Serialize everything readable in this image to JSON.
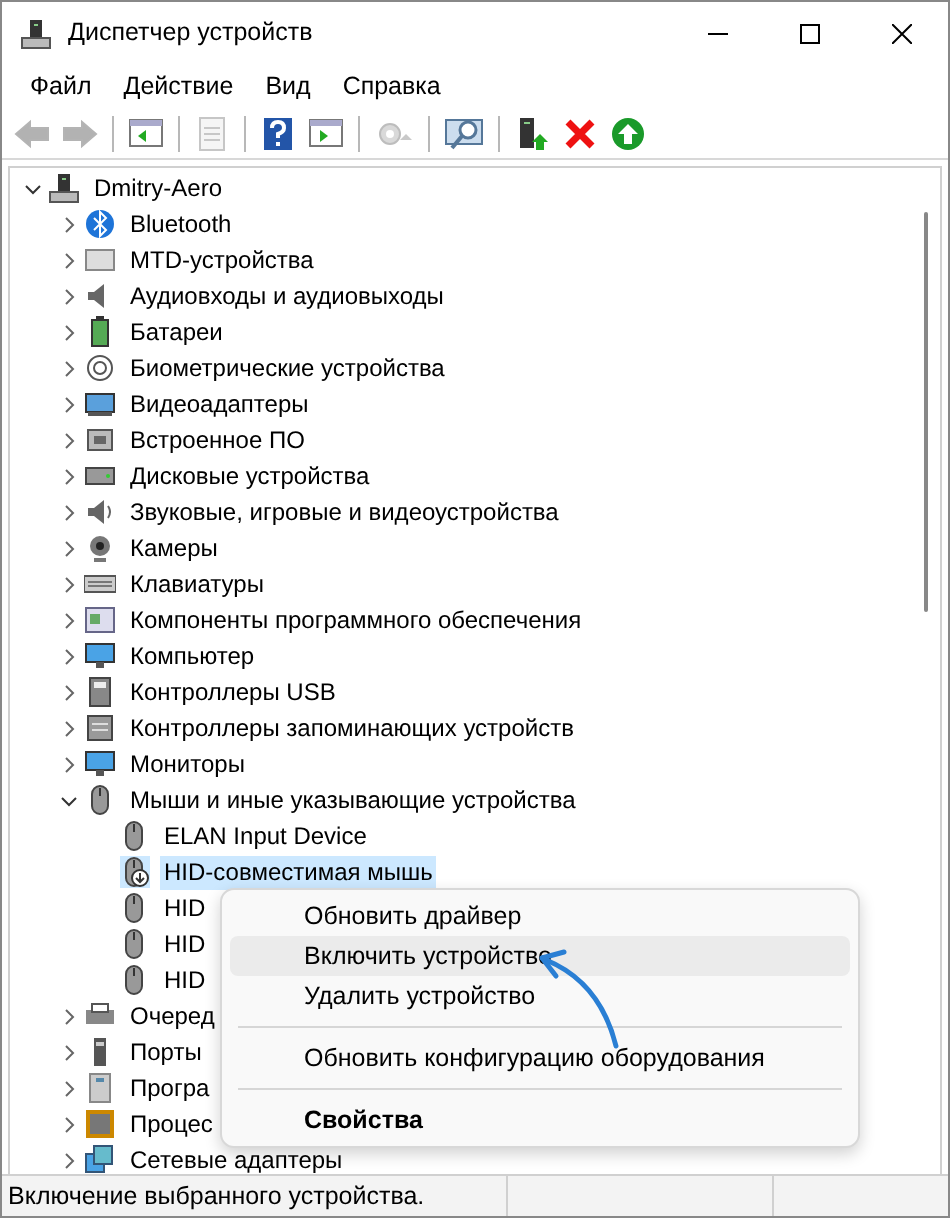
{
  "window": {
    "title": "Диспетчер устройств"
  },
  "menu": [
    "Файл",
    "Действие",
    "Вид",
    "Справка"
  ],
  "toolbar": [
    {
      "kind": "back",
      "disabled": true
    },
    {
      "kind": "forward",
      "disabled": true
    },
    {
      "kind": "sep"
    },
    {
      "kind": "tree-pane",
      "disabled": false
    },
    {
      "kind": "sep"
    },
    {
      "kind": "properties",
      "disabled": true
    },
    {
      "kind": "sep"
    },
    {
      "kind": "help",
      "disabled": false
    },
    {
      "kind": "action-pane",
      "disabled": false
    },
    {
      "kind": "sep"
    },
    {
      "kind": "update-driver",
      "disabled": true
    },
    {
      "kind": "sep"
    },
    {
      "kind": "scan",
      "disabled": false
    },
    {
      "kind": "sep"
    },
    {
      "kind": "device-add",
      "disabled": false
    },
    {
      "kind": "uninstall",
      "disabled": false
    },
    {
      "kind": "enable",
      "disabled": false
    }
  ],
  "tree": [
    {
      "label": "Dmitry-Aero",
      "expanded": true,
      "selected": false,
      "children": [
        {
          "label": "Bluetooth",
          "expanded": false,
          "selected": false
        },
        {
          "label": "MTD-устройства",
          "expanded": false,
          "selected": false
        },
        {
          "label": "Аудиовходы и аудиовыходы",
          "expanded": false,
          "selected": false
        },
        {
          "label": "Батареи",
          "expanded": false,
          "selected": false
        },
        {
          "label": "Биометрические устройства",
          "expanded": false,
          "selected": false
        },
        {
          "label": "Видеоадаптеры",
          "expanded": false,
          "selected": false
        },
        {
          "label": "Встроенное ПО",
          "expanded": false,
          "selected": false
        },
        {
          "label": "Дисковые устройства",
          "expanded": false,
          "selected": false
        },
        {
          "label": "Звуковые, игровые и видеоустройства",
          "expanded": false,
          "selected": false
        },
        {
          "label": "Камеры",
          "expanded": false,
          "selected": false
        },
        {
          "label": "Клавиатуры",
          "expanded": false,
          "selected": false
        },
        {
          "label": "Компоненты программного обеспечения",
          "expanded": false,
          "selected": false
        },
        {
          "label": "Компьютер",
          "expanded": false,
          "selected": false
        },
        {
          "label": "Контроллеры USB",
          "expanded": false,
          "selected": false
        },
        {
          "label": "Контроллеры запоминающих устройств",
          "expanded": false,
          "selected": false
        },
        {
          "label": "Мониторы",
          "expanded": false,
          "selected": false
        },
        {
          "label": "Мыши и иные указывающие устройства",
          "expanded": true,
          "selected": false,
          "children": [
            {
              "label": "ELAN Input Device",
              "selected": false,
              "disabled": false
            },
            {
              "label": "HID-совместимая мышь",
              "selected": true,
              "disabled": true
            },
            {
              "label": "HID",
              "selected": false,
              "disabled": false
            },
            {
              "label": "HID",
              "selected": false,
              "disabled": false
            },
            {
              "label": "HID",
              "selected": false,
              "disabled": false
            }
          ]
        },
        {
          "label": "Очеред",
          "expanded": false,
          "selected": false
        },
        {
          "label": "Порты",
          "expanded": false,
          "selected": false
        },
        {
          "label": "Програ",
          "expanded": false,
          "selected": false
        },
        {
          "label": "Процес",
          "expanded": false,
          "selected": false
        },
        {
          "label": "Сетевые адаптеры",
          "expanded": false,
          "selected": false
        }
      ]
    }
  ],
  "context_menu": [
    {
      "kind": "item",
      "label": "Обновить драйвер",
      "highlighted": false,
      "default": false
    },
    {
      "kind": "item",
      "label": "Включить устройство",
      "highlighted": true,
      "default": false
    },
    {
      "kind": "item",
      "label": "Удалить устройство",
      "highlighted": false,
      "default": false
    },
    {
      "kind": "separator"
    },
    {
      "kind": "item",
      "label": "Обновить конфигурацию оборудования",
      "highlighted": false,
      "default": false
    },
    {
      "kind": "separator"
    },
    {
      "kind": "item",
      "label": "Свойства",
      "highlighted": false,
      "default": true
    }
  ],
  "status_bar": {
    "text": "Включение выбранного устройства."
  }
}
